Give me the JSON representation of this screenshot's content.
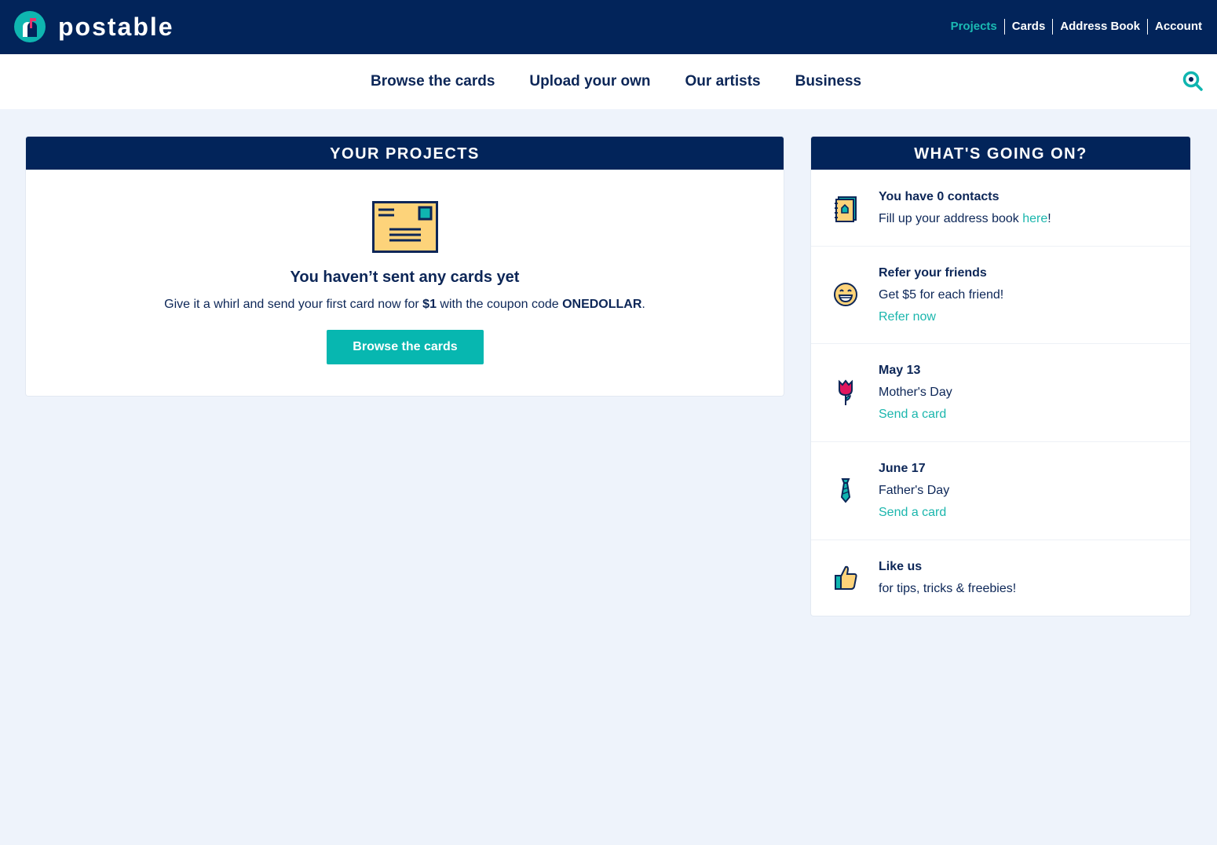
{
  "brand": {
    "name": "postable"
  },
  "account_nav": [
    {
      "label": "Projects",
      "active": true
    },
    {
      "label": "Cards"
    },
    {
      "label": "Address Book"
    },
    {
      "label": "Account"
    }
  ],
  "main_nav": [
    "Browse the cards",
    "Upload your own",
    "Our artists",
    "Business"
  ],
  "projects": {
    "title": "YOUR PROJECTS",
    "empty_title": "You haven’t sent any cards yet",
    "empty_text_1": "Give it a whirl and send your first card now for ",
    "price": "$1",
    "empty_text_2": " with the coupon code ",
    "coupon": "ONEDOLLAR",
    "empty_text_3": ".",
    "cta": "Browse the cards"
  },
  "news": {
    "title": "WHAT'S GOING ON?",
    "items": [
      {
        "icon": "address-book-icon",
        "title": "You have 0 contacts",
        "text": "Fill up your address book ",
        "link": "here",
        "after": "!"
      },
      {
        "icon": "smiley-icon",
        "title": "Refer your friends",
        "text": "Get $5 for each friend!",
        "link": "Refer now"
      },
      {
        "icon": "tulip-icon",
        "title": "May 13",
        "text": "Mother's Day",
        "link": "Send a card"
      },
      {
        "icon": "tie-icon",
        "title": "June 17",
        "text": "Father's Day",
        "link": "Send a card"
      },
      {
        "icon": "thumbs-up-icon",
        "title": "Like us",
        "text": "for tips, tricks & freebies!"
      }
    ]
  },
  "colors": {
    "navy": "#02245a",
    "teal": "#07b7b0",
    "background": "#eef3fb"
  }
}
